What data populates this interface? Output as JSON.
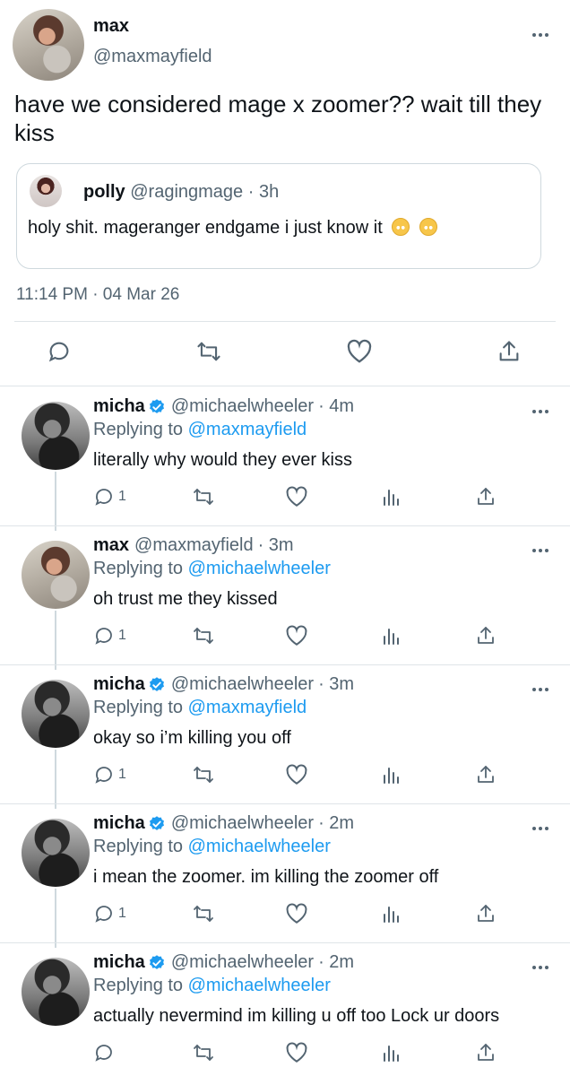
{
  "main_tweet": {
    "name": "max",
    "handle": "@maxmayfield",
    "text": "have we considered mage x zoomer?? wait till they kiss",
    "quote": {
      "name": "polly",
      "handle": "@ragingmage",
      "time": "· 3h",
      "text": "holy shit. mageranger endgame i just know it"
    },
    "timestamp": "11:14 PM · 04 Mar 26"
  },
  "replies": [
    {
      "name": "micha",
      "verified": true,
      "handle": "@michaelwheeler",
      "time": "· 4m",
      "replying_prefix": "Replying to",
      "replying_to": "@maxmayfield",
      "text": "literally why would they ever kiss",
      "reply_count": "1"
    },
    {
      "name": "max",
      "verified": false,
      "handle": "@maxmayfield",
      "time": "· 3m",
      "replying_prefix": "Replying to",
      "replying_to": "@michaelwheeler",
      "text": "oh trust me they kissed",
      "reply_count": "1"
    },
    {
      "name": "micha",
      "verified": true,
      "handle": "@michaelwheeler",
      "time": "· 3m",
      "replying_prefix": "Replying to",
      "replying_to": "@maxmayfield",
      "text": "okay so i’m killing you off",
      "reply_count": "1"
    },
    {
      "name": "micha",
      "verified": true,
      "handle": "@michaelwheeler",
      "time": "· 2m",
      "replying_prefix": "Replying to",
      "replying_to": "@michaelwheeler",
      "text": "i mean the zoomer. im killing the zoomer off",
      "reply_count": "1"
    },
    {
      "name": "micha",
      "verified": true,
      "handle": "@michaelwheeler",
      "time": "· 2m",
      "replying_prefix": "Replying to",
      "replying_to": "@michaelwheeler",
      "text": "actually nevermind im killing u off too Lock ur doors",
      "reply_count": ""
    }
  ],
  "colors": {
    "link": "#1d9bf0",
    "muted": "#536471",
    "text": "#0f1419",
    "border": "#cfd9de"
  },
  "icons": [
    "reply-icon",
    "retweet-icon",
    "like-icon",
    "share-icon",
    "views-icon",
    "verified-badge-icon",
    "more-options-icon",
    "pleading-face-emoji"
  ]
}
